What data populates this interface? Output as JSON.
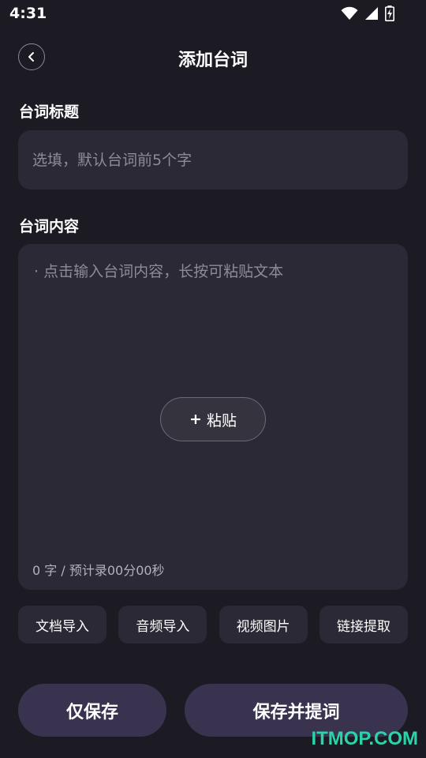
{
  "status_bar": {
    "time": "4:31"
  },
  "header": {
    "title": "添加台词"
  },
  "title_section": {
    "label": "台词标题",
    "placeholder": "选填，默认台词前5个字"
  },
  "content_section": {
    "label": "台词内容",
    "placeholder": "· 点击输入台词内容，长按可粘贴文本",
    "paste_icon": "+",
    "paste_label": "粘贴",
    "counter": "0 字 / 预计录00分00秒"
  },
  "import_options": [
    {
      "label": "文档导入"
    },
    {
      "label": "音频导入"
    },
    {
      "label": "视频图片"
    },
    {
      "label": "链接提取"
    }
  ],
  "actions": {
    "save_only": "仅保存",
    "save_and_prompt": "保存并提词"
  },
  "watermark": "ITMOP.COM",
  "colors": {
    "background": "#1c1b23",
    "card": "#2a2935",
    "button": "#3a3350",
    "watermark": "#2bd4a8"
  }
}
